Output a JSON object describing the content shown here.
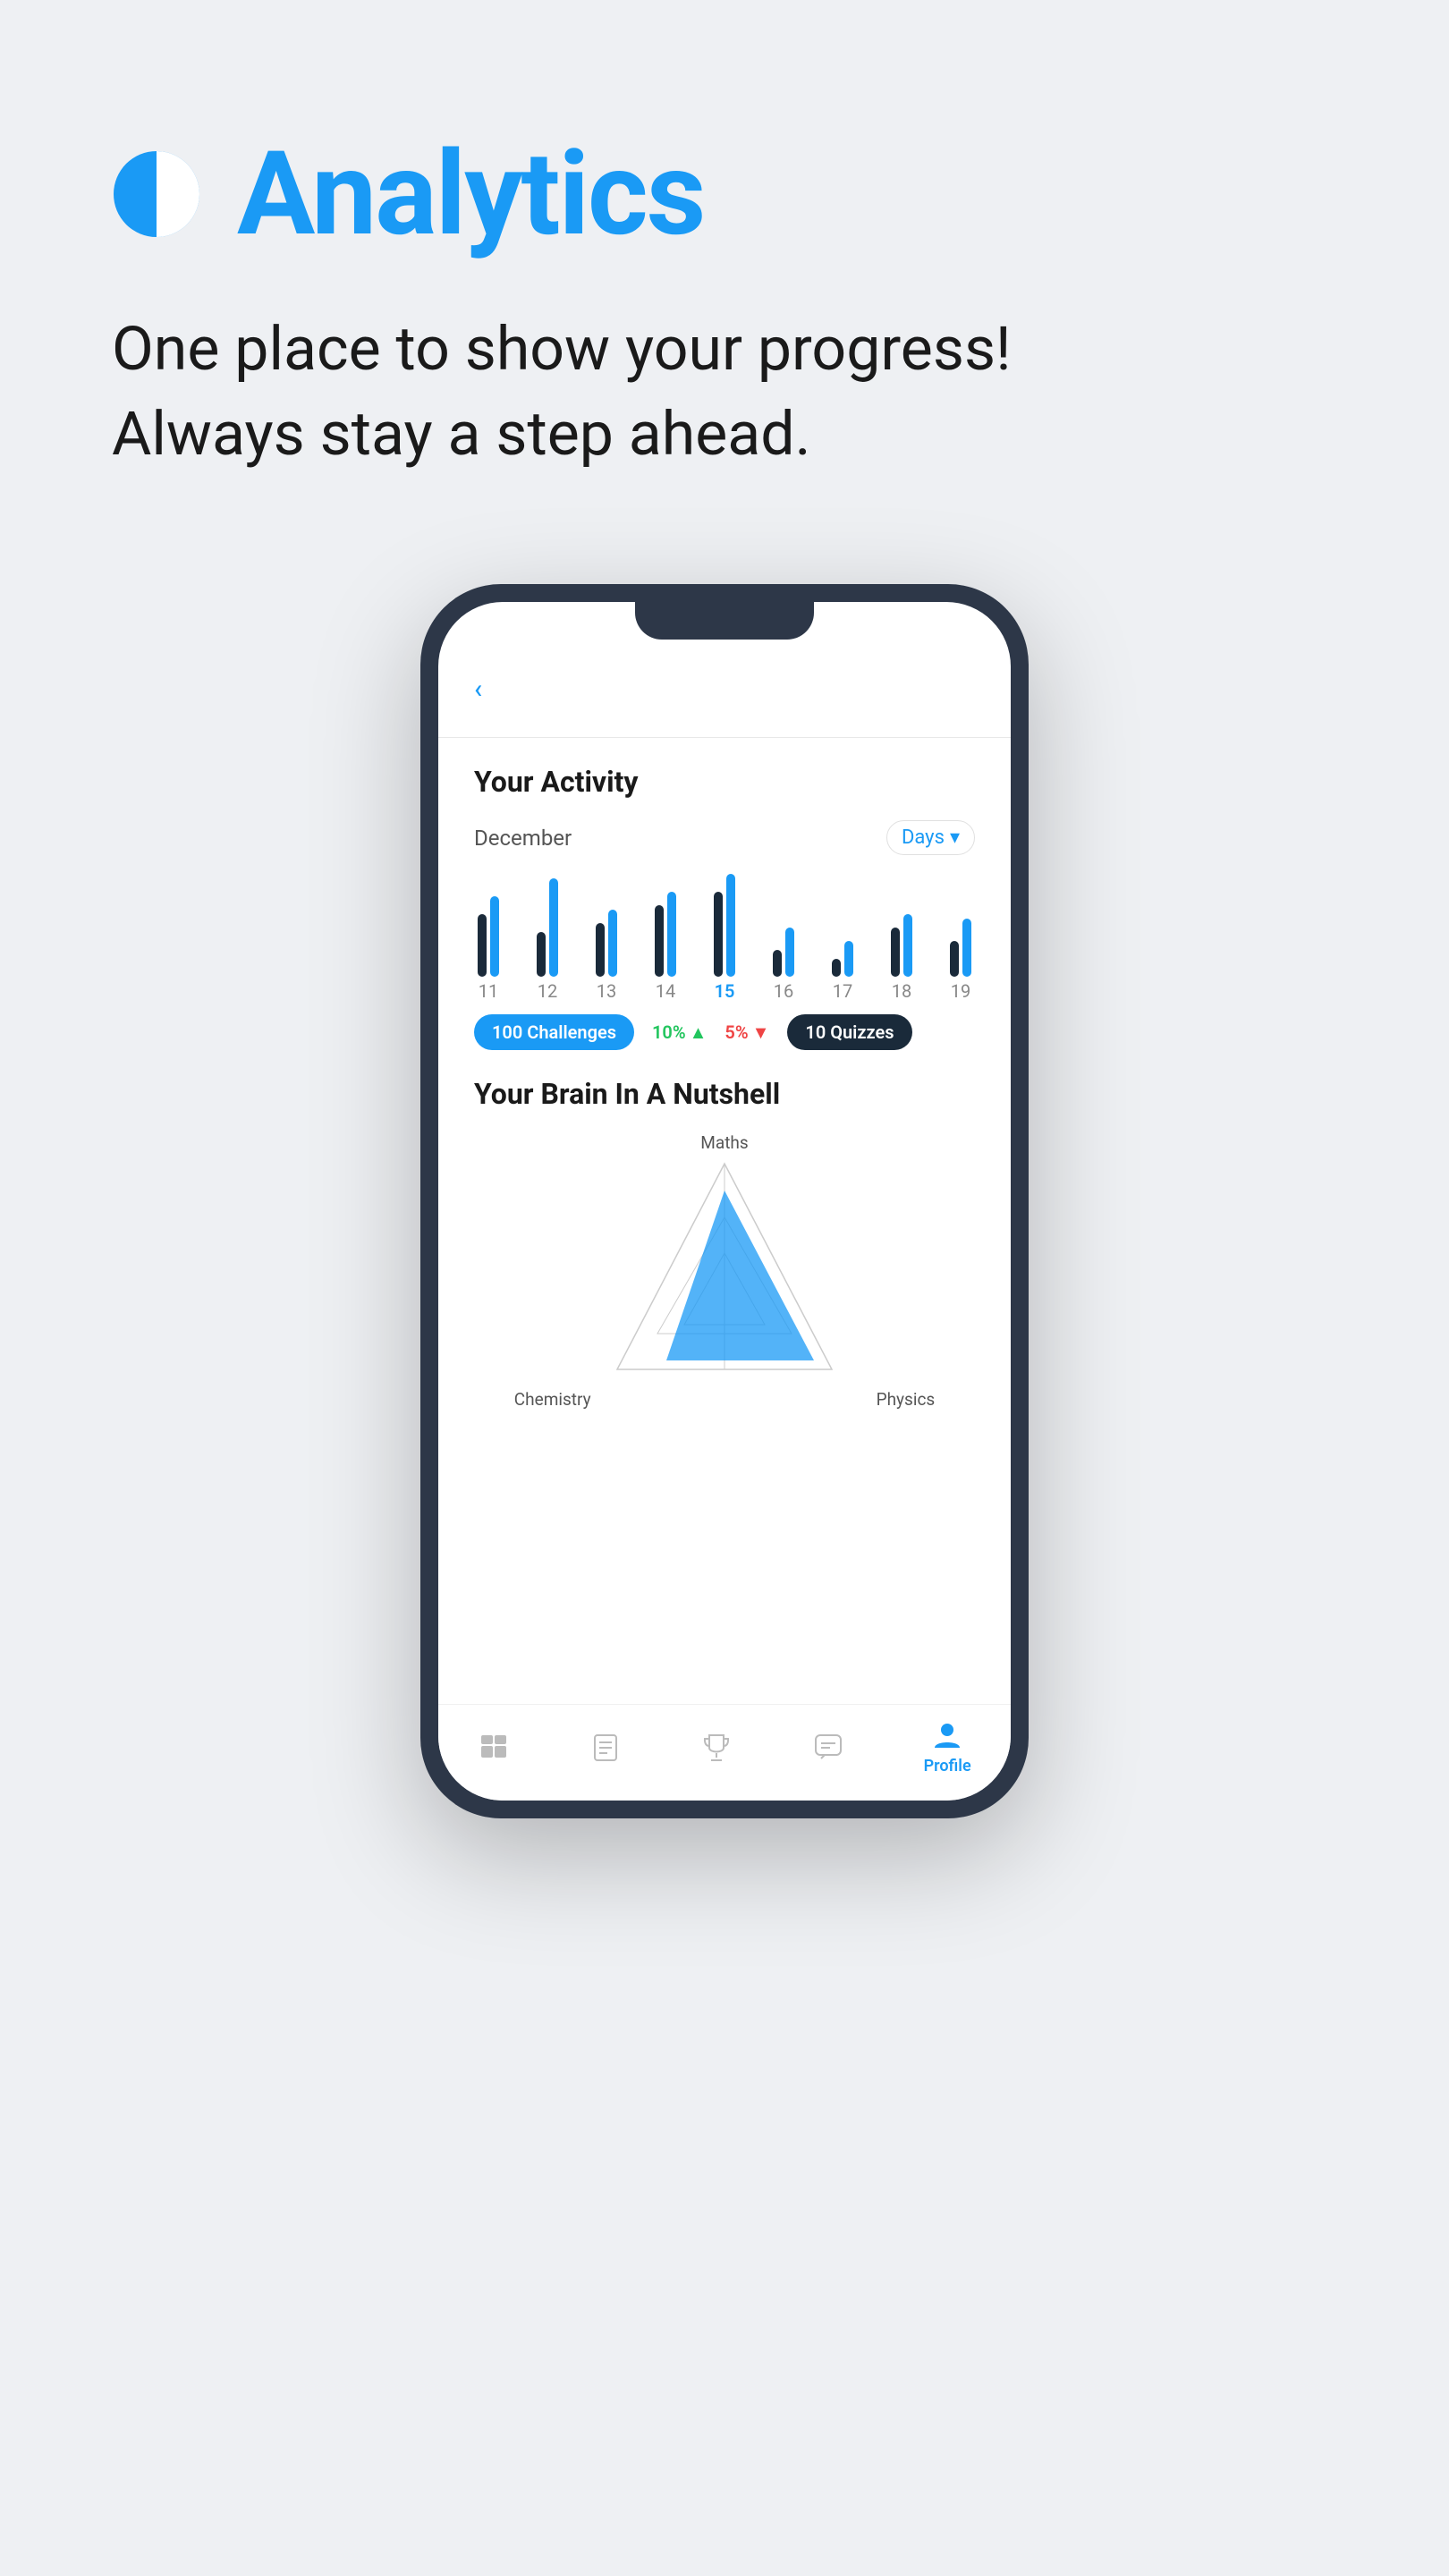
{
  "page": {
    "background_color": "#eef0f3"
  },
  "header": {
    "title": "Analytics",
    "subtitle_line1": "One place to show your progress!",
    "subtitle_line2": "Always stay a step ahead.",
    "icon": "analytics-icon"
  },
  "phone": {
    "back_label": "Back",
    "screen": {
      "activity": {
        "title": "Your Activity",
        "month": "December",
        "period_selector": "Days",
        "bars": [
          {
            "day": "11",
            "height_dark": 70,
            "height_blue": 90,
            "active": false
          },
          {
            "day": "12",
            "height_dark": 50,
            "height_blue": 110,
            "active": false
          },
          {
            "day": "13",
            "height_dark": 60,
            "height_blue": 75,
            "active": false
          },
          {
            "day": "14",
            "height_dark": 80,
            "height_blue": 95,
            "active": false
          },
          {
            "day": "15",
            "height_dark": 95,
            "height_blue": 115,
            "active": true
          },
          {
            "day": "16",
            "height_dark": 30,
            "height_blue": 55,
            "active": false
          },
          {
            "day": "17",
            "height_dark": 20,
            "height_blue": 40,
            "active": false
          },
          {
            "day": "18",
            "height_dark": 55,
            "height_blue": 70,
            "active": false
          },
          {
            "day": "19",
            "height_dark": 40,
            "height_blue": 65,
            "active": false
          }
        ],
        "stats": {
          "challenges": {
            "value": "100",
            "label": "Challenges"
          },
          "percent_up": {
            "value": "10%",
            "direction": "up"
          },
          "percent_down": {
            "value": "5%",
            "direction": "down"
          },
          "quizzes": {
            "value": "10",
            "label": "Quizzes"
          }
        }
      },
      "brain": {
        "title": "Your Brain In A Nutshell",
        "labels": {
          "top": "Maths",
          "bottom_left": "Chemistry",
          "bottom_right": "Physics"
        }
      },
      "nav": {
        "items": [
          {
            "id": "home",
            "label": "",
            "active": false
          },
          {
            "id": "lessons",
            "label": "",
            "active": false
          },
          {
            "id": "trophy",
            "label": "",
            "active": false
          },
          {
            "id": "chat",
            "label": "",
            "active": false
          },
          {
            "id": "profile",
            "label": "Profile",
            "active": true
          }
        ]
      }
    }
  }
}
